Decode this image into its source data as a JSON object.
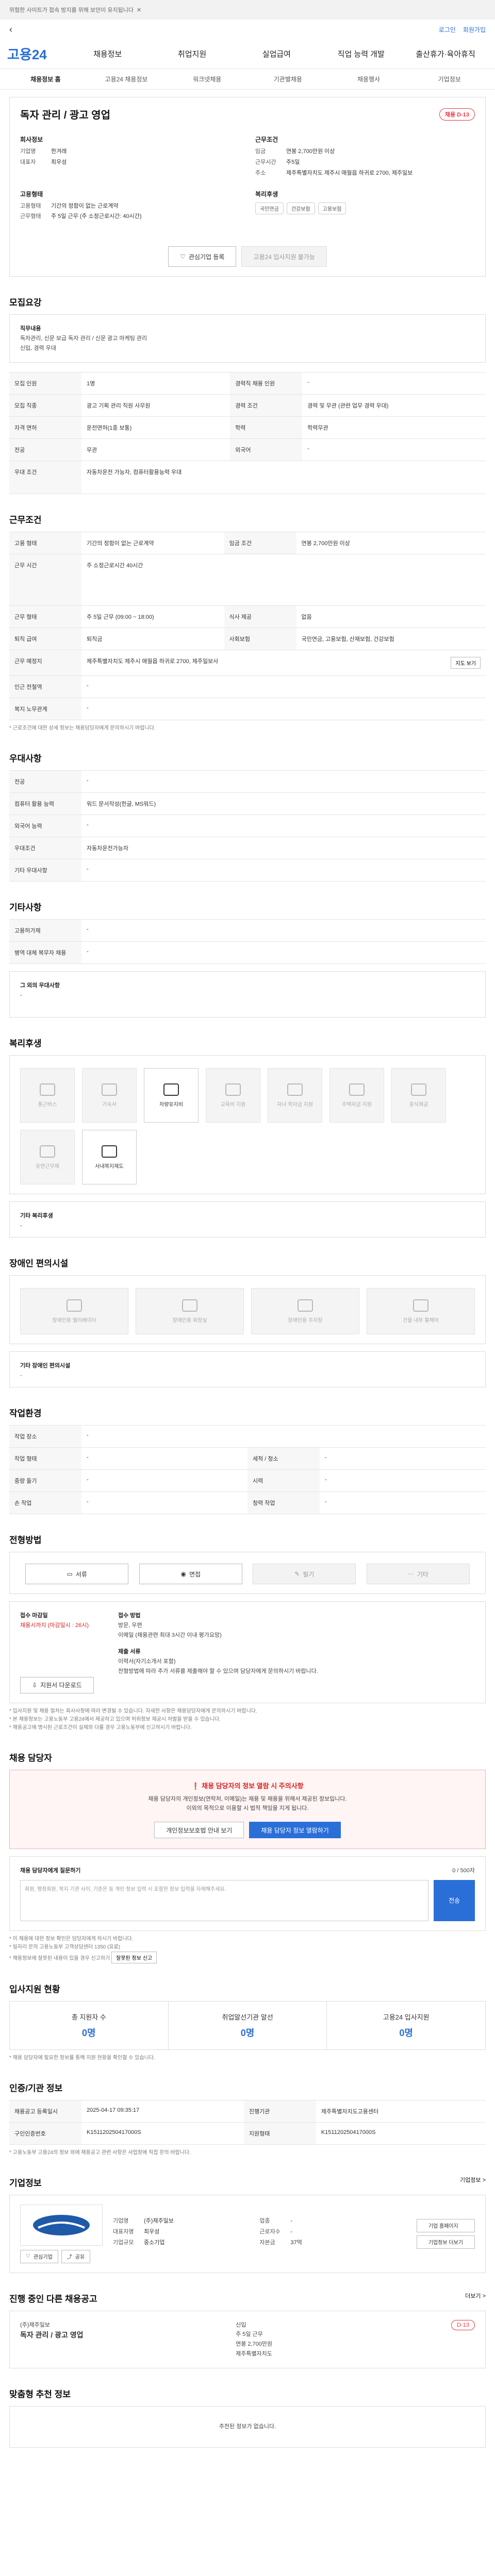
{
  "topbar": {
    "notice": "위험한 사이트가 접속 방지를 위해 보안이 유지됩니다"
  },
  "nav1": {
    "back": "‹",
    "login": "로그인",
    "join": "회원가입"
  },
  "brand": {
    "name": "고용24"
  },
  "main_nav": [
    "채용정보",
    "취업지원",
    "실업급여",
    "직업 능력 개발",
    "출산휴가·육아휴직"
  ],
  "sub_nav": [
    "채용정보 홈",
    "고용24 채용정보",
    "워크넷채용",
    "기관별채용",
    "채용행사",
    "기업정보"
  ],
  "job": {
    "title": "독자 관리 / 광고 영업",
    "badge": "채용 D-13",
    "company_label": "회사정보",
    "company_rows": [
      {
        "k": "기업명",
        "v": "한겨레"
      },
      {
        "k": "대표자",
        "v": "최우성"
      }
    ],
    "condition_label": "근무조건",
    "condition_rows": [
      {
        "k": "임금",
        "v": "연봉 2,700만원 이상"
      },
      {
        "k": "근무시간",
        "v": "주5일"
      },
      {
        "k": "주소",
        "v": "제주특별자치도 제주시 애월읍 하귀로 2700, 제주일보"
      }
    ],
    "work_label": "고용형태",
    "work_rows": [
      {
        "k": "고용형태",
        "v": "기간의 정함이 없는 근로계약"
      },
      {
        "k": "근무형태",
        "v": "주 5일 근무 (주 소정근로시간: 40시간)"
      }
    ],
    "welfare_label": "복리후생",
    "welfare_pills": [
      "국민연금",
      "건강보험",
      "고용보험"
    ],
    "btn_interest": "관심기업 등록",
    "btn_apply": "고용24 입사지원 불가능"
  },
  "recruit_section": {
    "title": "모집요강",
    "job_content_label": "직무내용",
    "job_content": "독자관리, 신문 보급 독자 관리 / 신문 광고 마케팅 관리",
    "job_content2": "신입, 경력 우대",
    "rows": [
      {
        "k": "모집 인원",
        "v": "1명",
        "k2": "경력직 채용 인원",
        "v2": "-"
      },
      {
        "k": "모집 직종",
        "v": "광고 기획 관리 직원 사무원",
        "k2": "경력 조건",
        "v2": "경력 및 무관 (관련 업무 경력 우대)"
      },
      {
        "k": "자격 면허",
        "v": "운전면허(1종 보통)",
        "k2": "학력",
        "v2": "학력무관"
      },
      {
        "k": "전공",
        "v": "무관",
        "k2": "외국어",
        "v2": "-"
      },
      {
        "k": "우대 조건",
        "v": "자동차운전 가능자, 컴퓨터활용능력 우대",
        "k2": "",
        "v2": ""
      }
    ]
  },
  "condition_section": {
    "title": "근무조건",
    "rows": [
      {
        "k": "고용 형태",
        "v": "기간의 정함이 없는 근로계약",
        "k2": "임금 조건",
        "v2": "연봉 2,700만원 이상"
      },
      {
        "k": "근무 시간",
        "v": "주 소정근로시간 40시간",
        "k2": "",
        "v2": ""
      },
      {
        "k": "근무 형태",
        "v": "주 5일 근무 (09:00 ~ 18:00)",
        "k2": "식사 제공",
        "v2": "없음"
      },
      {
        "k": "퇴직 급여",
        "v": "퇴직금",
        "k2": "사회보험",
        "v2": "국민연금, 고용보험, 산재보험, 건강보험"
      },
      {
        "k": "근무 예정지",
        "v": "제주특별자치도 제주시 애월읍 하귀로 2700, 제주일보사",
        "k2": "",
        "v2": ""
      },
      {
        "k": "인근 전철역",
        "v": "-",
        "k2": "",
        "v2": ""
      },
      {
        "k": "복지 노무관계",
        "v": "-",
        "k2": "",
        "v2": ""
      }
    ],
    "note": "* 근로조건에 대한 상세 정보는 채용담당자에게 문의하시기 바랍니다.",
    "map_btn": "지도 보기"
  },
  "method_section": {
    "title": "우대사항",
    "rows": [
      {
        "k": "전공",
        "v": "-"
      },
      {
        "k": "컴퓨터 활용 능력",
        "v": "워드 문서작성(한글, MS워드)"
      },
      {
        "k": "외국어 능력",
        "v": "-"
      },
      {
        "k": "우대조건",
        "v": "자동차운전가능자"
      },
      {
        "k": "기타 우대사항",
        "v": "-"
      }
    ]
  },
  "other_section": {
    "title": "기타사항",
    "rows": [
      {
        "k": "고용허가제",
        "v": "-"
      },
      {
        "k": "병역 대체 복무자 채용",
        "v": "-"
      }
    ],
    "extra_label": "그 외의 우대사항",
    "extra_value": "-"
  },
  "welfare_section": {
    "title": "복리후생",
    "items": [
      {
        "label": "통근버스",
        "on": false
      },
      {
        "label": "기숙사",
        "on": false
      },
      {
        "label": "차량유지비",
        "on": true
      },
      {
        "label": "교육비 지원",
        "on": false
      },
      {
        "label": "자녀 학자금 지원",
        "on": false
      },
      {
        "label": "주택자금 지원",
        "on": false
      },
      {
        "label": "중식제공",
        "on": false
      },
      {
        "label": "유연근무제",
        "on": false
      },
      {
        "label": "사내복지제도",
        "on": true
      }
    ],
    "extra_label": "기타 복리후생",
    "extra_value": "-"
  },
  "disabled_section": {
    "title": "장애인 편의시설",
    "items": [
      "장애인용 엘리베이터",
      "장애인용 화장실",
      "장애인용 주차장",
      "건물 내부 휠체어"
    ],
    "extra_label": "기타 장애인 편의시설",
    "extra_value": "-"
  },
  "env_section": {
    "title": "작업환경",
    "rows": [
      {
        "k": "작업 장소",
        "v": "-",
        "k2": "",
        "v2": ""
      },
      {
        "k": "작업 형태",
        "v": "-",
        "k2": "세척 / 청소",
        "v2": "-"
      },
      {
        "k": "중량 들기",
        "v": "-",
        "k2": "시력",
        "v2": "-"
      },
      {
        "k": "손 작업",
        "v": "-",
        "k2": "청력 작업",
        "v2": "-"
      }
    ]
  },
  "process_section": {
    "title": "전형방법",
    "steps": [
      "서류",
      "면접",
      "필기",
      "기타"
    ],
    "deadline_label": "접수 마감일",
    "deadline_value": "채용시까지 (마감일시 : 26시)",
    "method_label": "접수 방법",
    "method_value": "방문, 우편",
    "method_detail": "이메일 (채용관련 최대 3시간 이내 평가요망)",
    "docs_label": "제출 서류",
    "docs_value": "이력서(자기소개서 포함)",
    "docs_detail": "전형방법에 따라 추가 서류를 제출해야 할 수 있으며 담당자에게 문의하시기 바랍니다.",
    "btn": "지원서 다운로드",
    "notes": [
      "* 입사지원 및 채용 절차는 회사사정에 따라 변경될 수 있습니다. 자세한 사항은 채용담당자에게 문의하시기 바랍니다.",
      "* 본 채용정보는 고용노동부 고용24에서 제공하고 있으며 허위정보 제공시 처벌을 받을 수 있습니다.",
      "* 채용공고에 명시된 근로조건이 실제와 다를 경우 고용노동부에 신고하시기 바랍니다."
    ]
  },
  "contact_section": {
    "title": "채용 담당자",
    "warn_title": "채용 담당자의 정보 열람 시 주의사항",
    "warn_text": "채용 담당자의 개인정보(연락처, 이메일)는 채용 및 채용을 위해서 제공된 정보입니다.",
    "warn_text2": "이외의 목적으로 이용할 시 법적 책임을 지게 됩니다.",
    "btn_view": "개인정보보호법 안내 보기",
    "btn_contact": "채용 담당자 정보 열람하기",
    "ask_label": "채용 담당자에게 질문하기",
    "ask_count": "0 / 500자",
    "ask_placeholder": "회원, 행정회원, 복지 기관 사이, 기준은 등 개인 정보 입력 시 포함한 정보 입력을 자제해주세요.",
    "ask_btn": "전송",
    "notes": [
      "* 이 채용에 대한 정보 확인은 담당자에게 하시기 바랍니다.",
      "* 일자리 문의 고용노동부 고객상담센터 1350 (유료)",
      "* 채용정보에 잘못된 내용이 있을 경우 신고하기"
    ],
    "report_btn": "잘못된 정보 신고"
  },
  "status_section": {
    "title": "입사지원 현황",
    "items": [
      {
        "label": "총 지원자 수",
        "value": "0명"
      },
      {
        "label": "취업알선기관 알선",
        "value": "0명"
      },
      {
        "label": "고용24 입사지원",
        "value": "0명"
      }
    ],
    "note": "* 채용 담당자에 필요한 정보를 통해 지원 현황을 확인할 수 있습니다."
  },
  "info_section": {
    "title": "인증/기관 정보",
    "rows": [
      {
        "k": "채용공고 등록일시",
        "v": "2025-04-17 09:35:17",
        "k2": "진행기관",
        "v2": "제주특별자치도고용센터"
      },
      {
        "k": "구인인증번호",
        "v": "K151120250417000S",
        "k2": "지원형태",
        "v2": "K151120250417000S"
      }
    ],
    "note": "* 고용노동부 고용24의 정보 외에 채용공고 관련 사항은 사업장에 직접 문의 바랍니다."
  },
  "company_section": {
    "title": "기업정보",
    "more": "기업정보 >",
    "rows": [
      {
        "k": "기업명",
        "v": "(주)제주일보",
        "k2": "업종",
        "v2": "-"
      },
      {
        "k": "대표자명",
        "v": "최우성",
        "k2": "근로자수",
        "v2": "-"
      },
      {
        "k": "기업규모",
        "v": "중소기업",
        "k2": "자본금",
        "v2": "37억"
      }
    ],
    "btns": [
      "기업 홈페이지",
      "기업정보 더보기"
    ],
    "follow": "관심기업",
    "share": "공유"
  },
  "other_jobs": {
    "title": "진행 중인 다른 채용공고",
    "job_title": "독자 관리 / 광고 영업",
    "company": "(주)제주일보",
    "rows": [
      "신입",
      "주 5일 근무",
      "연봉 2,700만원",
      "제주특별자치도"
    ],
    "badge": "D-13",
    "more": "더보기 >"
  },
  "recommend": {
    "title": "맞춤형 추천 정보",
    "empty": "추천된 정보가 없습니다."
  }
}
